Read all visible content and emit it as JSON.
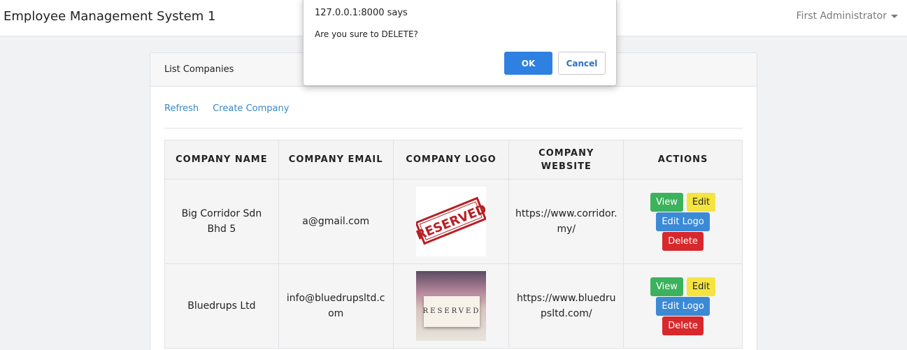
{
  "navbar": {
    "brand": "Employee Management System 1",
    "user": "First Administrator"
  },
  "card": {
    "title": "List Companies",
    "links": {
      "refresh": "Refresh",
      "create": "Create Company"
    }
  },
  "table": {
    "headers": [
      "COMPANY NAME",
      "COMPANY EMAIL",
      "COMPANY LOGO",
      "COMPANY WEBSITE",
      "ACTIONS"
    ],
    "rows": [
      {
        "name": "Big Corridor Sdn Bhd 5",
        "email": "a@gmail.com",
        "logo_text": "RESERVED",
        "website": "https://www.corridor.my/"
      },
      {
        "name": "Bluedrups Ltd",
        "email": "info@bluedrupsltd.com",
        "logo_text": "RESERVED",
        "website": "https://www.bluedrupsltd.com/"
      }
    ],
    "actions": {
      "view": "View",
      "edit": "Edit",
      "edit_logo": "Edit Logo",
      "delete": "Delete"
    }
  },
  "dialog": {
    "title": "127.0.0.1:8000 says",
    "message": "Are you sure to DELETE?",
    "ok": "OK",
    "cancel": "Cancel"
  },
  "colors": {
    "view": "#3cb25c",
    "edit": "#f5e440",
    "edit_logo": "#3b8ad6",
    "delete": "#d7282c",
    "link": "#3b87c6",
    "dialog_ok": "#2e81e0"
  }
}
